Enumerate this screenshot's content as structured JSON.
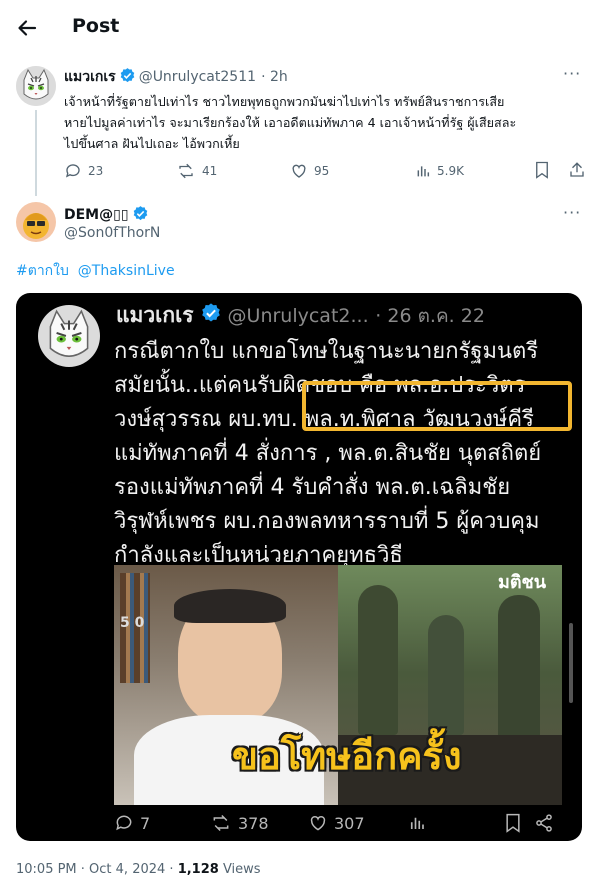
{
  "header": {
    "title": "Post"
  },
  "reply_to": {
    "name": "แมวเกเร",
    "handle": "@Unrulycat2511",
    "time": "· 2h",
    "text_lines": [
      "เจ้าหน้าที่รัฐตายไปเท่าไร ชาวไทยพุทธถูกพวกมันฆ่าไปเท่าไร ทรัพย์สินราชการเสีย",
      "หายไปมูลค่าเท่าไร จะมาเรียกร้องให้ เอาอดีตแม่ทัพภาค 4 เอาเจ้าหน้าที่รัฐ ผู้เสียสละ",
      "ไปขึ้นศาล ฝันไปเถอะ ไอ้พวกเหี้ย"
    ],
    "replies": "23",
    "reposts": "41",
    "likes": "95",
    "views": "5.9K"
  },
  "main": {
    "name": "DEM@▯▯",
    "handle": "@Son0fThorN",
    "hashtag": "#ตากใบ",
    "mention": "@ThaksinLive"
  },
  "card": {
    "name": "แมวเกเร",
    "handle": "@Unrulycat2...",
    "date": "· 26 ต.ค. 22",
    "lines": [
      "กรณีตากใบ แกขอโทษในฐานะนายกรัฐมนตรี",
      "สมัยนั้น..แต่คนรับผิดชอบ คือ พล.อ.ประวิตร",
      "วงษ์สุวรรณ ผบ.ทบ. พล.ท.พิศาล วัฒนวงษ์คีรี",
      "แม่ทัพภาคที่ 4 สั่งการ , พล.ต.สินชัย นุตสถิตย์",
      "รองแม่ทัพภาคที่ 4 รับคำสั่ง พล.ต.เฉลิมชัย",
      "วิรุฬห์เพชร ผบ.กองพลทหารราบที่ 5 ผู้ควบคุม",
      "กำลังและเป็นหน่วยภาคยุทธวิธี"
    ],
    "image_caption": "ขอโทษอีกครั้ง",
    "watermark": "มติชน",
    "replies": "7",
    "reposts": "378",
    "likes": "307"
  },
  "footer": {
    "time": "10:05 PM · Oct 4, 2024 · ",
    "views_count": "1,128",
    "views_label": " Views"
  }
}
